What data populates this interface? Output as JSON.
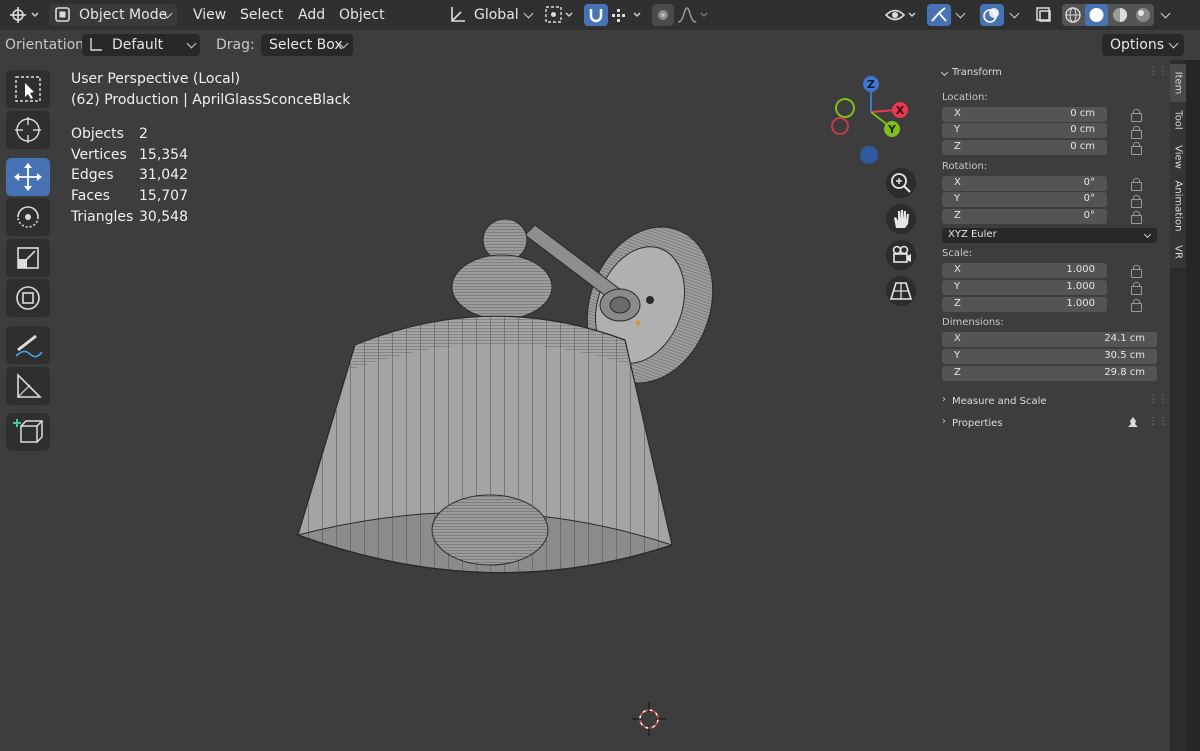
{
  "header": {
    "mode": "Object Mode",
    "menus": [
      "View",
      "Select",
      "Add",
      "Object"
    ],
    "transform_orientation": "Global"
  },
  "subheader": {
    "orientation_label": "Orientation:",
    "orientation_value": "Default",
    "drag_label": "Drag:",
    "drag_value": "Select Box",
    "options": "Options"
  },
  "viewport": {
    "view_name": "User Perspective (Local)",
    "collection": "(62) Production | AprilGlassSconceBlack",
    "stats": [
      {
        "label": "Objects",
        "value": "2"
      },
      {
        "label": "Vertices",
        "value": "15,354"
      },
      {
        "label": "Edges",
        "value": "31,042"
      },
      {
        "label": "Faces",
        "value": "15,707"
      },
      {
        "label": "Triangles",
        "value": "30,548"
      }
    ]
  },
  "gizmo": {
    "z": "Z",
    "x": "X",
    "y": "Y"
  },
  "npanel": {
    "transform_title": "Transform",
    "location_label": "Location:",
    "location": [
      {
        "axis": "X",
        "value": "0 cm"
      },
      {
        "axis": "Y",
        "value": "0 cm"
      },
      {
        "axis": "Z",
        "value": "0 cm"
      }
    ],
    "rotation_label": "Rotation:",
    "rotation": [
      {
        "axis": "X",
        "value": "0°"
      },
      {
        "axis": "Y",
        "value": "0°"
      },
      {
        "axis": "Z",
        "value": "0°"
      }
    ],
    "rotation_mode": "XYZ Euler",
    "scale_label": "Scale:",
    "scale": [
      {
        "axis": "X",
        "value": "1.000"
      },
      {
        "axis": "Y",
        "value": "1.000"
      },
      {
        "axis": "Z",
        "value": "1.000"
      }
    ],
    "dimensions_label": "Dimensions:",
    "dimensions": [
      {
        "axis": "X",
        "value": "24.1 cm"
      },
      {
        "axis": "Y",
        "value": "30.5 cm"
      },
      {
        "axis": "Z",
        "value": "29.8 cm"
      }
    ],
    "measure_title": "Measure and Scale",
    "properties_title": "Properties"
  },
  "tabs": [
    "Item",
    "Tool",
    "View",
    "Animation",
    "VR"
  ],
  "colors": {
    "accent": "#4772b3",
    "axis_x": "#e83a4f",
    "axis_y": "#80bd1e",
    "axis_z": "#3d77d1"
  }
}
